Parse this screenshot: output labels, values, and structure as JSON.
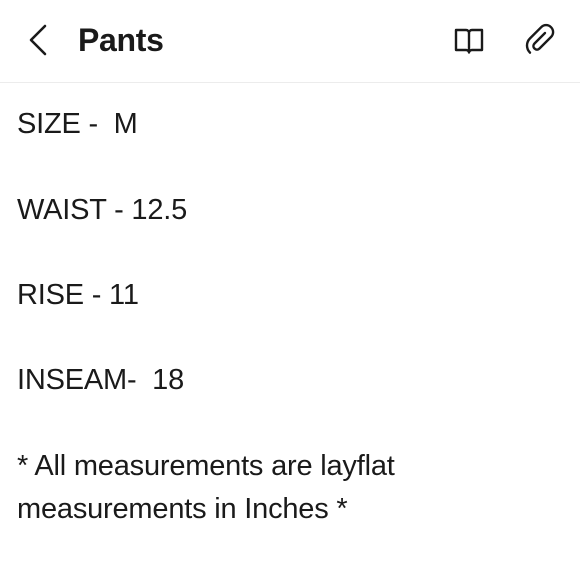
{
  "header": {
    "title": "Pants",
    "back_icon": "chevron-left-icon",
    "reader_icon": "open-book-icon",
    "attach_icon": "paperclip-icon"
  },
  "note": {
    "lines": [
      "SIZE -  M",
      "WAIST - 12.5",
      "RISE - 11",
      "INSEAM-  18"
    ],
    "footer": "* All measurements are layflat measurements in Inches *"
  },
  "colors": {
    "text": "#1a1a1a",
    "background": "#ffffff",
    "divider": "#ececec"
  }
}
